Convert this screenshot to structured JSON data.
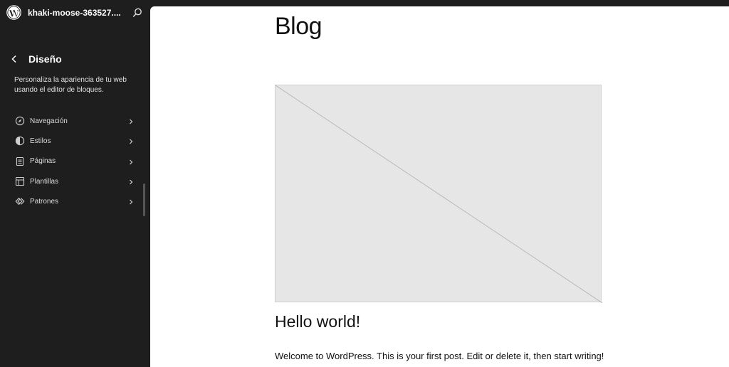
{
  "site": {
    "title": "khaki-moose-363527....",
    "logo_icon": "wordpress-logo-icon",
    "search_icon": "search-icon"
  },
  "panel": {
    "title": "Diseño",
    "description": "Personaliza la apariencia de tu web usando el editor de bloques."
  },
  "nav": {
    "items": [
      {
        "label": "Navegación",
        "icon": "compass-icon"
      },
      {
        "label": "Estilos",
        "icon": "half-circle-styles-icon"
      },
      {
        "label": "Páginas",
        "icon": "page-icon"
      },
      {
        "label": "Plantillas",
        "icon": "layout-icon"
      },
      {
        "label": "Patrones",
        "icon": "diamond-icon"
      }
    ]
  },
  "preview": {
    "blog_title": "Blog",
    "post_title": "Hello world!",
    "post_excerpt": "Welcome to WordPress. This is your first post. Edit or delete it, then start writing!"
  },
  "colors": {
    "sidebar_bg": "#1e1e1e",
    "canvas_bg": "#ffffff",
    "placeholder_bg": "#e6e6e6"
  }
}
